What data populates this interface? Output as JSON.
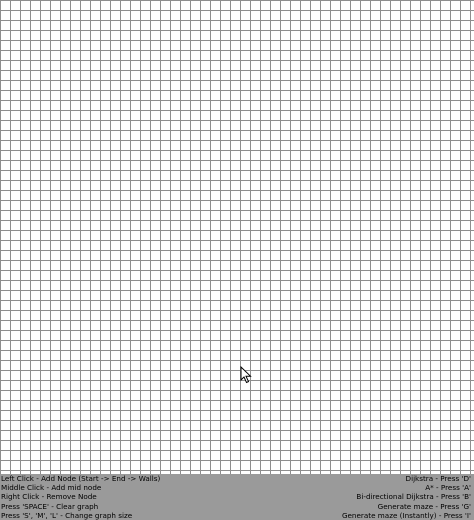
{
  "canvas": {
    "grid_line_color": "#8e8e8e",
    "background_color": "#ffffff"
  },
  "cursor": {
    "icon": "arrow-pointer-icon"
  },
  "help_panel": {
    "background_color": "#9a9a9a",
    "left_lines": [
      "Left Click - Add Node (Start -> End -> Walls)",
      "Middle Click - Add mid node",
      "Right Click - Remove Node",
      "Press 'SPACE' - Clear graph",
      "Press 'S', 'M', 'L' - Change graph size"
    ],
    "right_lines": [
      "Dijkstra - Press 'D'",
      "A* - Press 'A'",
      "Bi-directional Dijkstra - Press 'B'",
      "Generate maze - Press 'G'",
      "Generate maze (Instantly) - Press 'I'"
    ]
  }
}
